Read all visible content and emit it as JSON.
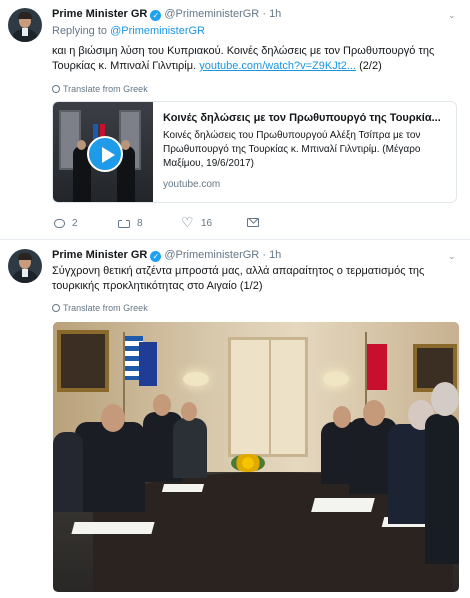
{
  "tweets": [
    {
      "author_name": "Prime Minister GR",
      "handle": "@PrimeministerGR",
      "separator": "·",
      "time": "1h",
      "replying_label": "Replying to",
      "replying_to": "@PrimeministerGR",
      "text": "και η βιώσιμη λύση του Κυπριακού. Κοινές δηλώσεις με τον Πρωθυπουργό της Τουρκίας κ. Μπιναλί Γιλντιρίμ.",
      "link_text": "youtube.com/watch?v=Z9KJt2...",
      "thread_marker": "(2/2)",
      "translate_label": "Translate from Greek",
      "card": {
        "title": "Κοινές δηλώσεις με τον Πρωθυπουργό της Τουρκία...",
        "description": "Κοινές δηλώσεις του Πρωθυπουργού Αλέξη Τσίπρα με τον Πρωθυπουργό της Τουρκίας κ. Μπιναλί Γιλντιρίμ. (Μέγαρο Μαξίμου, 19/6/2017)",
        "domain": "youtube.com"
      },
      "actions": {
        "replies": "2",
        "retweets": "8",
        "likes": "16"
      }
    },
    {
      "author_name": "Prime Minister GR",
      "handle": "@PrimeministerGR",
      "separator": "·",
      "time": "1h",
      "text": "Σύγχρονη θετική ατζέντα μπροστά μας, αλλά απαραίτητος ο τερματισμός της τουρκικής προκλητικότητας στο Αιγαίο (1/2)",
      "translate_label": "Translate from Greek"
    }
  ],
  "colors": {
    "accent": "#1b95e0",
    "muted": "#657786",
    "verified": "#1da1f2",
    "text": "#14171a",
    "border": "#e6ecf0"
  },
  "icons": [
    "verified-badge-icon",
    "chevron-down-icon",
    "globe-icon",
    "play-icon",
    "reply-icon",
    "retweet-icon",
    "like-icon",
    "direct-message-icon"
  ]
}
